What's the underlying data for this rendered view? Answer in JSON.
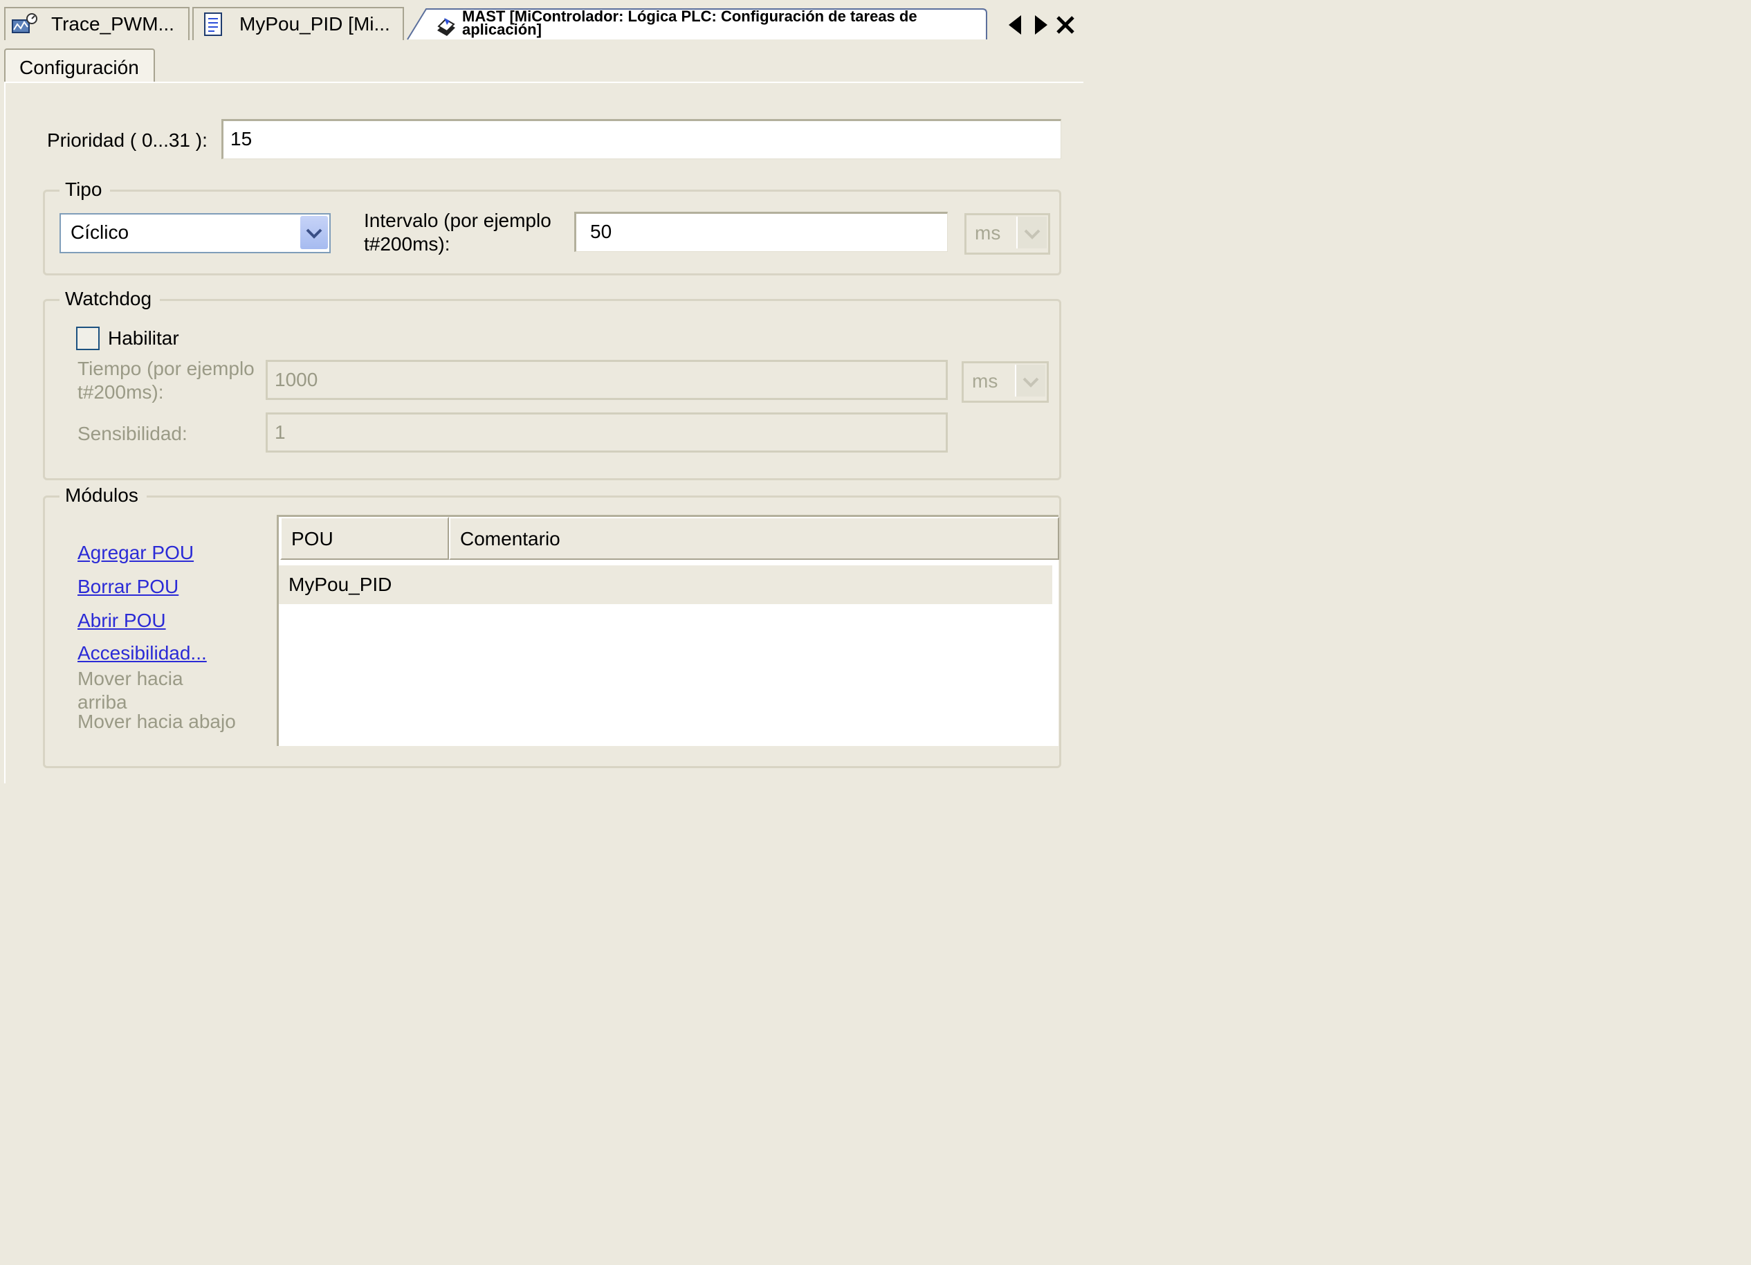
{
  "doc_tabs": [
    {
      "label": "Trace_PWM...",
      "icon": "trace-icon"
    },
    {
      "label": "MyPou_PID [Mi...",
      "icon": "pou-document-icon"
    }
  ],
  "active_tab": {
    "line1": "MAST [MiControlador: Lógica PLC: Configuración de tareas de",
    "line2": "aplicación]",
    "icon": "task-icon"
  },
  "sub_tab": "Configuración",
  "priority": {
    "label": "Prioridad ( 0...31 ):",
    "value": "15"
  },
  "tipo": {
    "title": "Tipo",
    "selected": "Cíclico",
    "interval_label_1": "Intervalo (por ejemplo",
    "interval_label_2": "t#200ms):",
    "interval_value": "50",
    "unit": "ms"
  },
  "watchdog": {
    "title": "Watchdog",
    "enable_label": "Habilitar",
    "enabled": false,
    "time_label_1": "Tiempo (por ejemplo",
    "time_label_2": "t#200ms):",
    "time_value": "1000",
    "time_unit": "ms",
    "sensitivity_label": "Sensibilidad:",
    "sensitivity_value": "1"
  },
  "modules": {
    "title": "Módulos",
    "actions": {
      "add": "Agregar POU",
      "delete": "Borrar POU",
      "open": "Abrir POU",
      "access": "Accesibilidad...",
      "move_up_1": "Mover hacia",
      "move_up_2": "arriba",
      "move_down": "Mover hacia abajo"
    },
    "columns": [
      "POU",
      "Comentario"
    ],
    "rows": [
      {
        "pou": "MyPou_PID",
        "comment": ""
      }
    ]
  }
}
